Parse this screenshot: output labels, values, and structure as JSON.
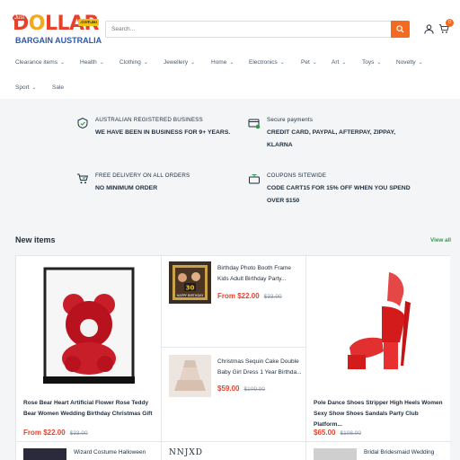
{
  "header": {
    "logo": {
      "tag": "Just",
      "word_d": "D",
      "word_o": "O",
      "word_llar": "LLAR",
      "badge": ".com.au",
      "sub": "BARGAIN AUSTRALIA"
    },
    "search_placeholder": "Search...",
    "cart_count": "0"
  },
  "nav": {
    "items": [
      {
        "label": "Clearance items"
      },
      {
        "label": "Health"
      },
      {
        "label": "Clothing"
      },
      {
        "label": "Jewellery"
      },
      {
        "label": "Home"
      },
      {
        "label": "Electronics"
      },
      {
        "label": "Pet"
      },
      {
        "label": "Art"
      },
      {
        "label": "Toys"
      },
      {
        "label": "Novelty"
      },
      {
        "label": "Sport"
      },
      {
        "label": "Sale"
      }
    ]
  },
  "features": [
    {
      "icon": "shield-badge-icon",
      "title": "AUSTRALIAN REGISTERED BUSINESS",
      "desc": "WE HAVE BEEN IN BUSINESS FOR 9+ YEARS."
    },
    {
      "icon": "payment-card-icon",
      "title": "Secure payments",
      "desc": "CREDIT CARD, PAYPAL, AFTERPAY, ZIPPAY, KLARNA"
    },
    {
      "icon": "delivery-cart-icon",
      "title": "FREE DELIVERY ON ALL ORDERS",
      "desc": "NO MINIMUM ORDER"
    },
    {
      "icon": "coupon-box-icon",
      "title": "COUPONS SITEWIDE",
      "desc": "CODE CART15 FOR 15% OFF WHEN YOU SPEND OVER $150"
    }
  ],
  "new_items": {
    "title": "New items",
    "view_all": "View all",
    "products": [
      {
        "title": "Rose Bear Heart Artificial Flower Rose Teddy Bear Women Wedding Birthday Christmas Gift",
        "price": "From $22.00",
        "old_price": "$33.00"
      },
      {
        "title": "Birthday Photo Booth Frame Kids Adult Birthday Party...",
        "price": "From $22.00",
        "old_price": "$33.00"
      },
      {
        "title": "Christmas Sequin Cake Double Baby Girl Dress 1 Year Birthda...",
        "price": "$59.00",
        "old_price": "$109.00"
      },
      {
        "title": "Pole Dance Shoes Stripper High Heels Women Sexy Show Shoes Sandals Party Club Platform...",
        "price": "$65.00",
        "old_price": "$108.00"
      },
      {
        "title": "Wizard Costume Halloween"
      },
      {
        "title": "NNJXD"
      },
      {
        "title": "Bridal Bridesmaid Wedding"
      }
    ],
    "photo_booth_text": "HAPPY BIRTHDAY",
    "photo_booth_age": "30"
  },
  "colors": {
    "accent": "#f26b21",
    "price": "#e8412a",
    "link_green": "#2f9a4a",
    "text": "#1e2d3d"
  }
}
